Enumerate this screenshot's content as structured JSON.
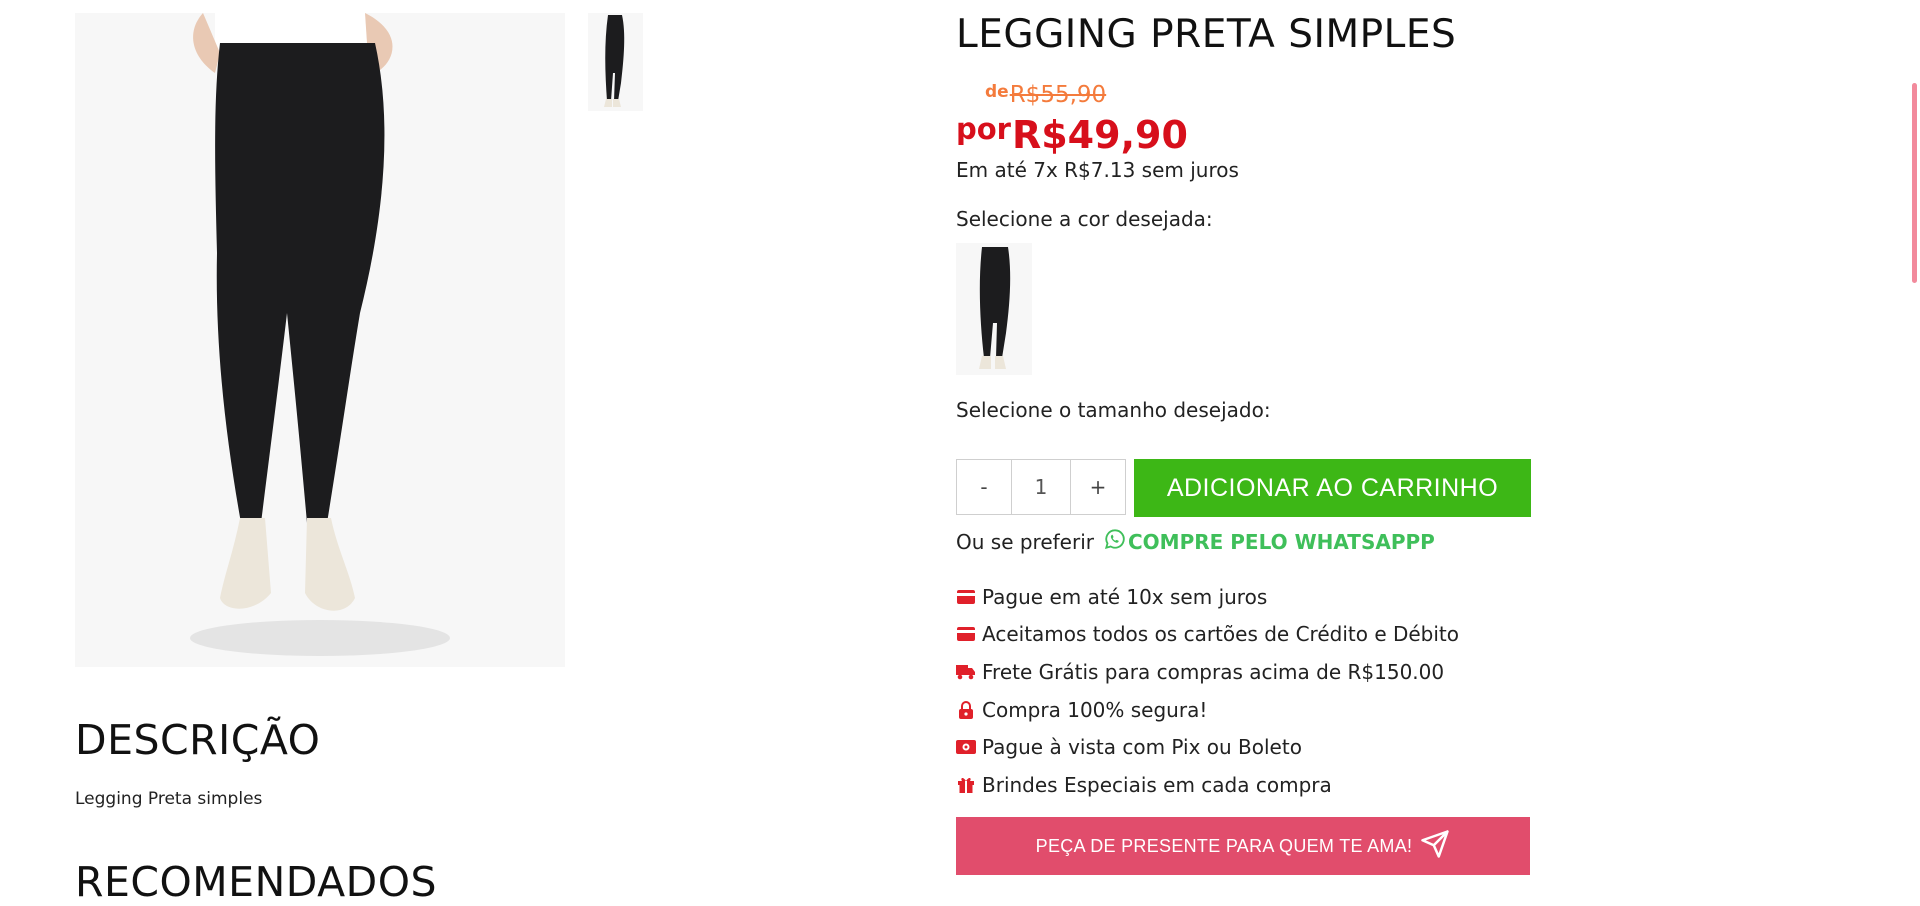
{
  "product": {
    "title": "LEGGING PRETA SIMPLES",
    "old_price_prefix": "de",
    "old_price": "R$55,90",
    "price_prefix": "por",
    "price": "R$49,90",
    "installments": "Em até 7x R$7.13 sem juros"
  },
  "selectors": {
    "color_label": "Selecione a cor desejada:",
    "size_label": "Selecione o tamanho desejado:"
  },
  "cart": {
    "minus_label": "-",
    "quantity": "1",
    "plus_label": "+",
    "add_label": "ADICIONAR AO CARRINHO"
  },
  "whatsapp": {
    "prefix": "Ou se preferir",
    "link_label": "COMPRE PELO WHATSAPPP"
  },
  "benefits": [
    {
      "icon": "credit-card-icon",
      "text": "Pague em até 10x sem juros"
    },
    {
      "icon": "credit-card-icon",
      "text": "Aceitamos todos os cartões de Crédito e Débito"
    },
    {
      "icon": "truck-icon",
      "text": "Frete Grátis para compras acima de R$150.00"
    },
    {
      "icon": "lock-icon",
      "text": "Compra 100% segura!"
    },
    {
      "icon": "money-icon",
      "text": "Pague à vista com Pix ou Boleto"
    },
    {
      "icon": "gift-icon",
      "text": "Brindes Especiais em cada compra"
    }
  ],
  "gift_button": {
    "label": "PEÇA DE PRESENTE PARA QUEM TE AMA!",
    "icon": "send-icon"
  },
  "description": {
    "heading": "DESCRIÇÃO",
    "text": "Legging Preta simples"
  },
  "recommended": {
    "heading": "RECOMENDADOS"
  },
  "colors": {
    "accent_green": "#3db716",
    "price_red": "#d70f1b",
    "old_price_orange": "#f47b3c",
    "gift_pink": "#e14d6c",
    "icon_red": "#e0202a",
    "whatsapp_green": "#3fbf5a"
  }
}
